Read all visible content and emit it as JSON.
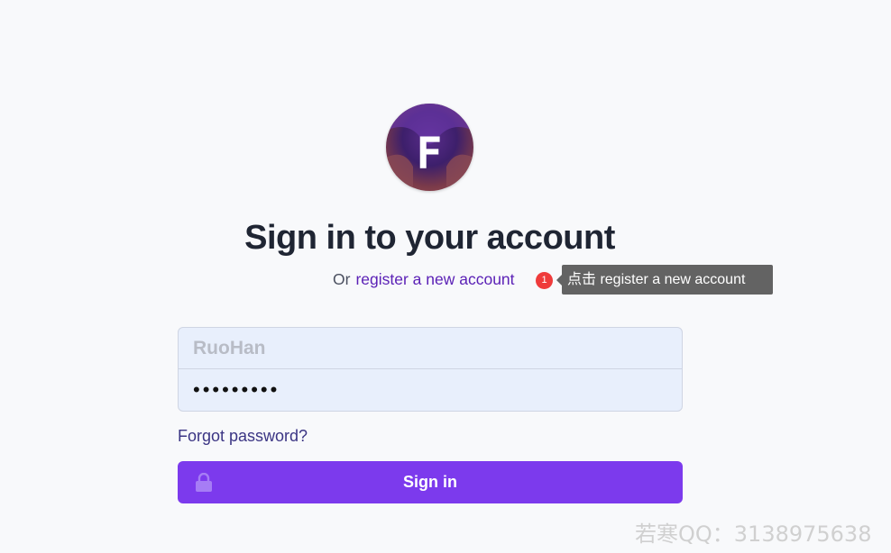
{
  "logo": {
    "letter": "F"
  },
  "heading": "Sign in to your account",
  "subline": {
    "prefix": "Or",
    "register_link": "register a new account"
  },
  "tour_hint": {
    "step": "1",
    "text": "点击 register a new account"
  },
  "form": {
    "username_placeholder": "RuoHan",
    "password_value": "•••••••••"
  },
  "forgot_link": "Forgot password?",
  "signin_button": "Sign in",
  "watermark": "若寒QQ：3138975638"
}
